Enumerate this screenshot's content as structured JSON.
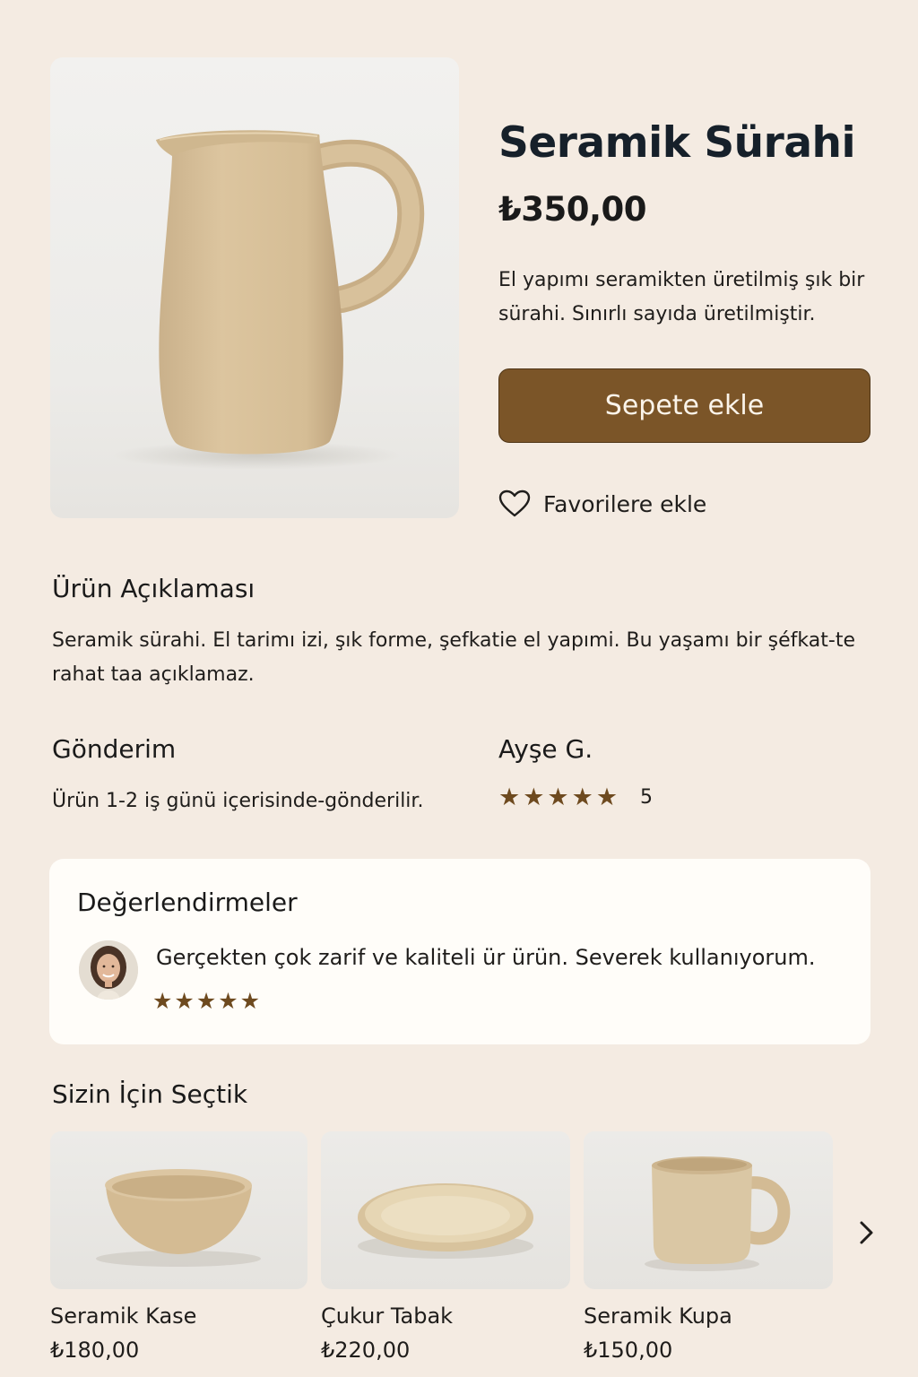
{
  "product": {
    "title": "Seramik Sürahi",
    "price": "₺350,00",
    "short_description": "El yapımı seramikten üretilmiş şık bir sürahi. Sınırlı sayıda üretilmiştir.",
    "add_to_cart_label": "Sepete ekle",
    "favorite_label": "Favorilere ekle",
    "image_icon": "ceramic-pitcher-image"
  },
  "description": {
    "heading": "Ürün Açıklaması",
    "text": "Seramik sürahi. El tarimı izi,  şık forme, şefkatie el yapımi. Bu yaşamı bir şéfkat-te rahat taa açıklamaz."
  },
  "shipping": {
    "heading": "Gönderim",
    "text": "Ürün 1-2 iş günü içerisinde-gönderilir."
  },
  "rating_summary": {
    "reviewer": "Ayşe G.",
    "stars": "★★★★★",
    "score": "5"
  },
  "reviews": {
    "heading": "Değerlendirmeler",
    "items": [
      {
        "text": "Gerçekten çok zarif ve kaliteli ür ürün. Severek kullanıyorum.",
        "stars": "★★★★★"
      }
    ]
  },
  "recommendations": {
    "heading": "Sizin İçin Seçtik",
    "items": [
      {
        "name": "Seramik Kase",
        "price": "₺180,00",
        "icon": "bowl-image"
      },
      {
        "name": "Çukur Tabak",
        "price": "₺220,00",
        "icon": "plate-image"
      },
      {
        "name": "Seramik Kupa",
        "price": "₺150,00",
        "icon": "mug-image"
      }
    ],
    "next_icon": "chevron-right-icon"
  },
  "colors": {
    "background": "#f4ebe2",
    "accent": "#7b5528",
    "star": "#6e4a1f",
    "ceramic": "#d9c39c"
  }
}
